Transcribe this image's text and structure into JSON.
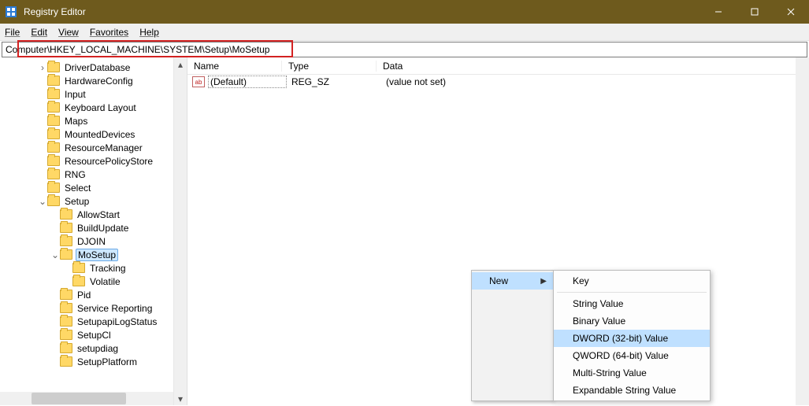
{
  "window": {
    "title": "Registry Editor"
  },
  "menu": {
    "file": "File",
    "edit": "Edit",
    "view": "View",
    "favorites": "Favorites",
    "help": "Help"
  },
  "address": {
    "path": "Computer\\HKEY_LOCAL_MACHINE\\SYSTEM\\Setup\\MoSetup"
  },
  "tree": [
    {
      "indent": 3,
      "toggle": ">",
      "label": "DriverDatabase"
    },
    {
      "indent": 3,
      "toggle": "",
      "label": "HardwareConfig"
    },
    {
      "indent": 3,
      "toggle": "",
      "label": "Input"
    },
    {
      "indent": 3,
      "toggle": "",
      "label": "Keyboard Layout"
    },
    {
      "indent": 3,
      "toggle": "",
      "label": "Maps"
    },
    {
      "indent": 3,
      "toggle": "",
      "label": "MountedDevices"
    },
    {
      "indent": 3,
      "toggle": "",
      "label": "ResourceManager"
    },
    {
      "indent": 3,
      "toggle": "",
      "label": "ResourcePolicyStore"
    },
    {
      "indent": 3,
      "toggle": "",
      "label": "RNG"
    },
    {
      "indent": 3,
      "toggle": "",
      "label": "Select"
    },
    {
      "indent": 3,
      "toggle": "v",
      "label": "Setup"
    },
    {
      "indent": 4,
      "toggle": "",
      "label": "AllowStart"
    },
    {
      "indent": 4,
      "toggle": "",
      "label": "BuildUpdate"
    },
    {
      "indent": 4,
      "toggle": "",
      "label": "DJOIN"
    },
    {
      "indent": 4,
      "toggle": "v",
      "label": "MoSetup",
      "selected": true
    },
    {
      "indent": 5,
      "toggle": "",
      "label": "Tracking"
    },
    {
      "indent": 5,
      "toggle": "",
      "label": "Volatile"
    },
    {
      "indent": 4,
      "toggle": "",
      "label": "Pid"
    },
    {
      "indent": 4,
      "toggle": "",
      "label": "Service Reporting"
    },
    {
      "indent": 4,
      "toggle": "",
      "label": "SetupapiLogStatus"
    },
    {
      "indent": 4,
      "toggle": "",
      "label": "SetupCl"
    },
    {
      "indent": 4,
      "toggle": "",
      "label": "setupdiag"
    },
    {
      "indent": 4,
      "toggle": "",
      "label": "SetupPlatform"
    }
  ],
  "columns": {
    "name": "Name",
    "type": "Type",
    "data": "Data"
  },
  "values_row": {
    "icon": "ab",
    "name": "(Default)",
    "type": "REG_SZ",
    "data": "(value not set)"
  },
  "context": {
    "parent": "New",
    "items": [
      "Key",
      "---",
      "String Value",
      "Binary Value",
      "DWORD (32-bit) Value",
      "QWORD (64-bit) Value",
      "Multi-String Value",
      "Expandable String Value"
    ],
    "highlighted": "DWORD (32-bit) Value"
  }
}
